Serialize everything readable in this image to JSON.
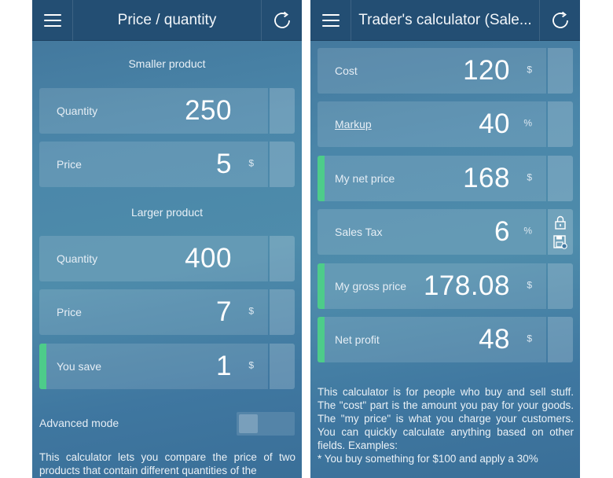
{
  "left_screen": {
    "title": "Price / quantity",
    "smaller_label": "Smaller product",
    "larger_label": "Larger product",
    "rows": [
      {
        "label": "Quantity",
        "value": "250",
        "unit": ""
      },
      {
        "label": "Price",
        "value": "5",
        "unit": "$"
      },
      {
        "label": "Quantity",
        "value": "400",
        "unit": ""
      },
      {
        "label": "Price",
        "value": "7",
        "unit": "$"
      },
      {
        "label": "You save",
        "value": "1",
        "unit": "$"
      }
    ],
    "advanced_mode_label": "Advanced mode",
    "description": "This calculator lets you compare the price of two products that contain different quantities of the"
  },
  "right_screen": {
    "title": "Trader's calculator (Sale...",
    "rows": [
      {
        "label": "Cost",
        "value": "120",
        "unit": "$"
      },
      {
        "label": "Markup",
        "value": "40",
        "unit": "%"
      },
      {
        "label": "My net price",
        "value": "168",
        "unit": "$"
      },
      {
        "label": "Sales Tax",
        "value": "6",
        "unit": "%"
      },
      {
        "label": "My gross price",
        "value": "178.08",
        "unit": "$"
      },
      {
        "label": "Net profit",
        "value": "48",
        "unit": "$"
      }
    ],
    "description": "This calculator is for people who buy and sell stuff. The \"cost\" part is the amount you pay for your goods. The \"my price\" is what you charge your customers. You can quickly calculate anything based on other fields. Examples:",
    "example": "* You buy something for $100 and apply a 30%"
  },
  "colors": {
    "topbar": "#234e73",
    "accent": "#4dcc8a",
    "background": "#4a86a9"
  },
  "icons": {
    "menu": "hamburger-menu-icon",
    "refresh": "refresh-icon",
    "lock": "lock-icon",
    "save": "save-icon"
  }
}
